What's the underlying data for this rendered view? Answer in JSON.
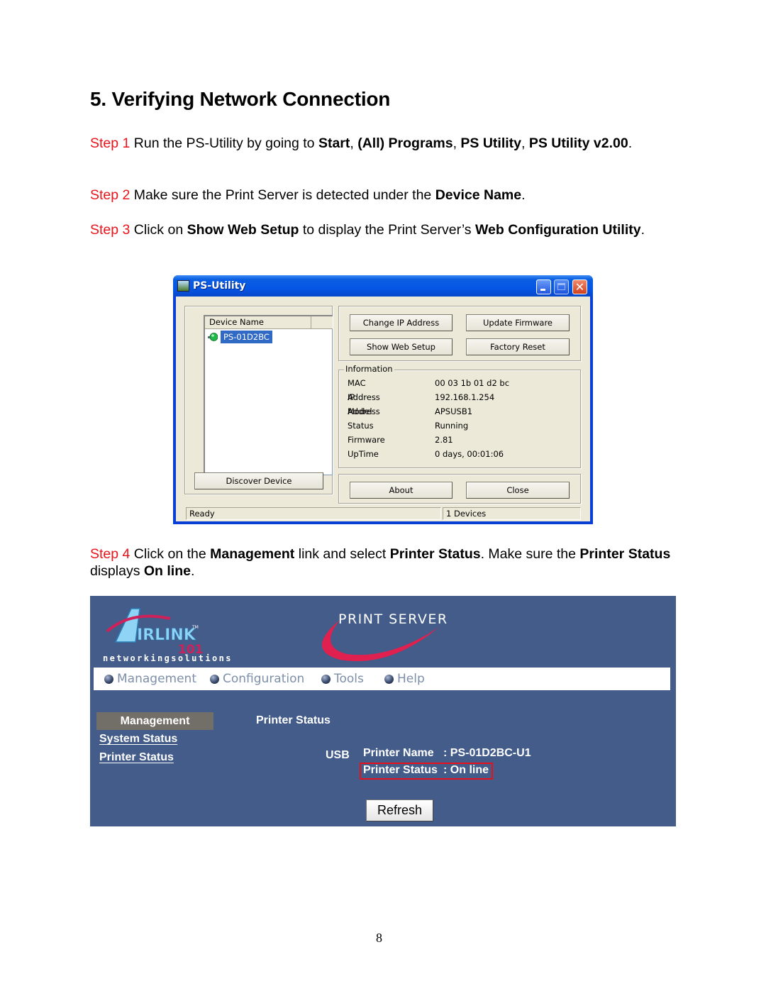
{
  "doc": {
    "title": "5. Verifying Network Connection",
    "page_number": "8",
    "steps": [
      {
        "label": "Step 1",
        "parts": [
          " Run the PS-Utility by going to ",
          "Start",
          ", ",
          "(All) Programs",
          ", ",
          "PS Utility",
          ", ",
          "PS Utility v2.00",
          "."
        ]
      },
      {
        "label": "Step 2",
        "parts": [
          " Make sure the Print Server is detected under the ",
          "Device Name",
          "."
        ]
      },
      {
        "label": "Step 3",
        "parts": [
          " Click on ",
          "Show Web Setup",
          " to display the Print Server’s ",
          "Web Configuration Utility",
          "."
        ]
      },
      {
        "label": "Step 4",
        "parts": [
          " Click on the ",
          "Management",
          " link and select ",
          "Printer Status",
          ". Make sure the ",
          "Printer Status",
          " displays ",
          "On line",
          "."
        ]
      }
    ]
  },
  "ps_utility": {
    "window_title": "PS-Utility",
    "device_list": {
      "column_header": "Device Name",
      "items": [
        {
          "name": "PS-01D2BC",
          "selected": true
        }
      ]
    },
    "buttons": {
      "change_ip": "Change IP Address",
      "update_firmware": "Update Firmware",
      "show_web_setup": "Show Web Setup",
      "factory_reset": "Factory Reset",
      "discover_device": "Discover Device",
      "about": "About",
      "close": "Close"
    },
    "information": {
      "legend": "Information",
      "rows": [
        {
          "label": "MAC Address",
          "value": "00 03 1b 01 d2 bc"
        },
        {
          "label": "IP Address",
          "value": "192.168.1.254"
        },
        {
          "label": "Model",
          "value": "APSUSB1"
        },
        {
          "label": "Status",
          "value": "Running"
        },
        {
          "label": "Firmware",
          "value": "2.81"
        },
        {
          "label": "UpTime",
          "value": "0 days, 00:01:06"
        }
      ]
    },
    "statusbar": {
      "left": "Ready",
      "right": "1 Devices"
    },
    "icons": {
      "title": "app-icon",
      "device": "printer-server-green-icon"
    }
  },
  "web_ui": {
    "brand": {
      "logo_text": "AIRLINK",
      "logo_number": "101",
      "tagline": "networkingsolutions",
      "product": "PRINT SERVER"
    },
    "nav": [
      "Management",
      "Configuration",
      "Tools",
      "Help"
    ],
    "sidebar": {
      "header": "Management",
      "links": [
        "System Status",
        "Printer Status"
      ]
    },
    "content": {
      "heading": "Printer Status",
      "port": "USB",
      "printer_name_label": "Printer Name",
      "printer_name_value": ": PS-01D2BC-U1",
      "printer_status_label": "Printer Status",
      "printer_status_value": ": On line",
      "refresh_button": "Refresh"
    },
    "colors": {
      "background": "#435c8a",
      "highlight_box": "#e8101b",
      "sidebar_header": "#726e68"
    }
  },
  "colors": {
    "step_label": "#e8141b"
  }
}
